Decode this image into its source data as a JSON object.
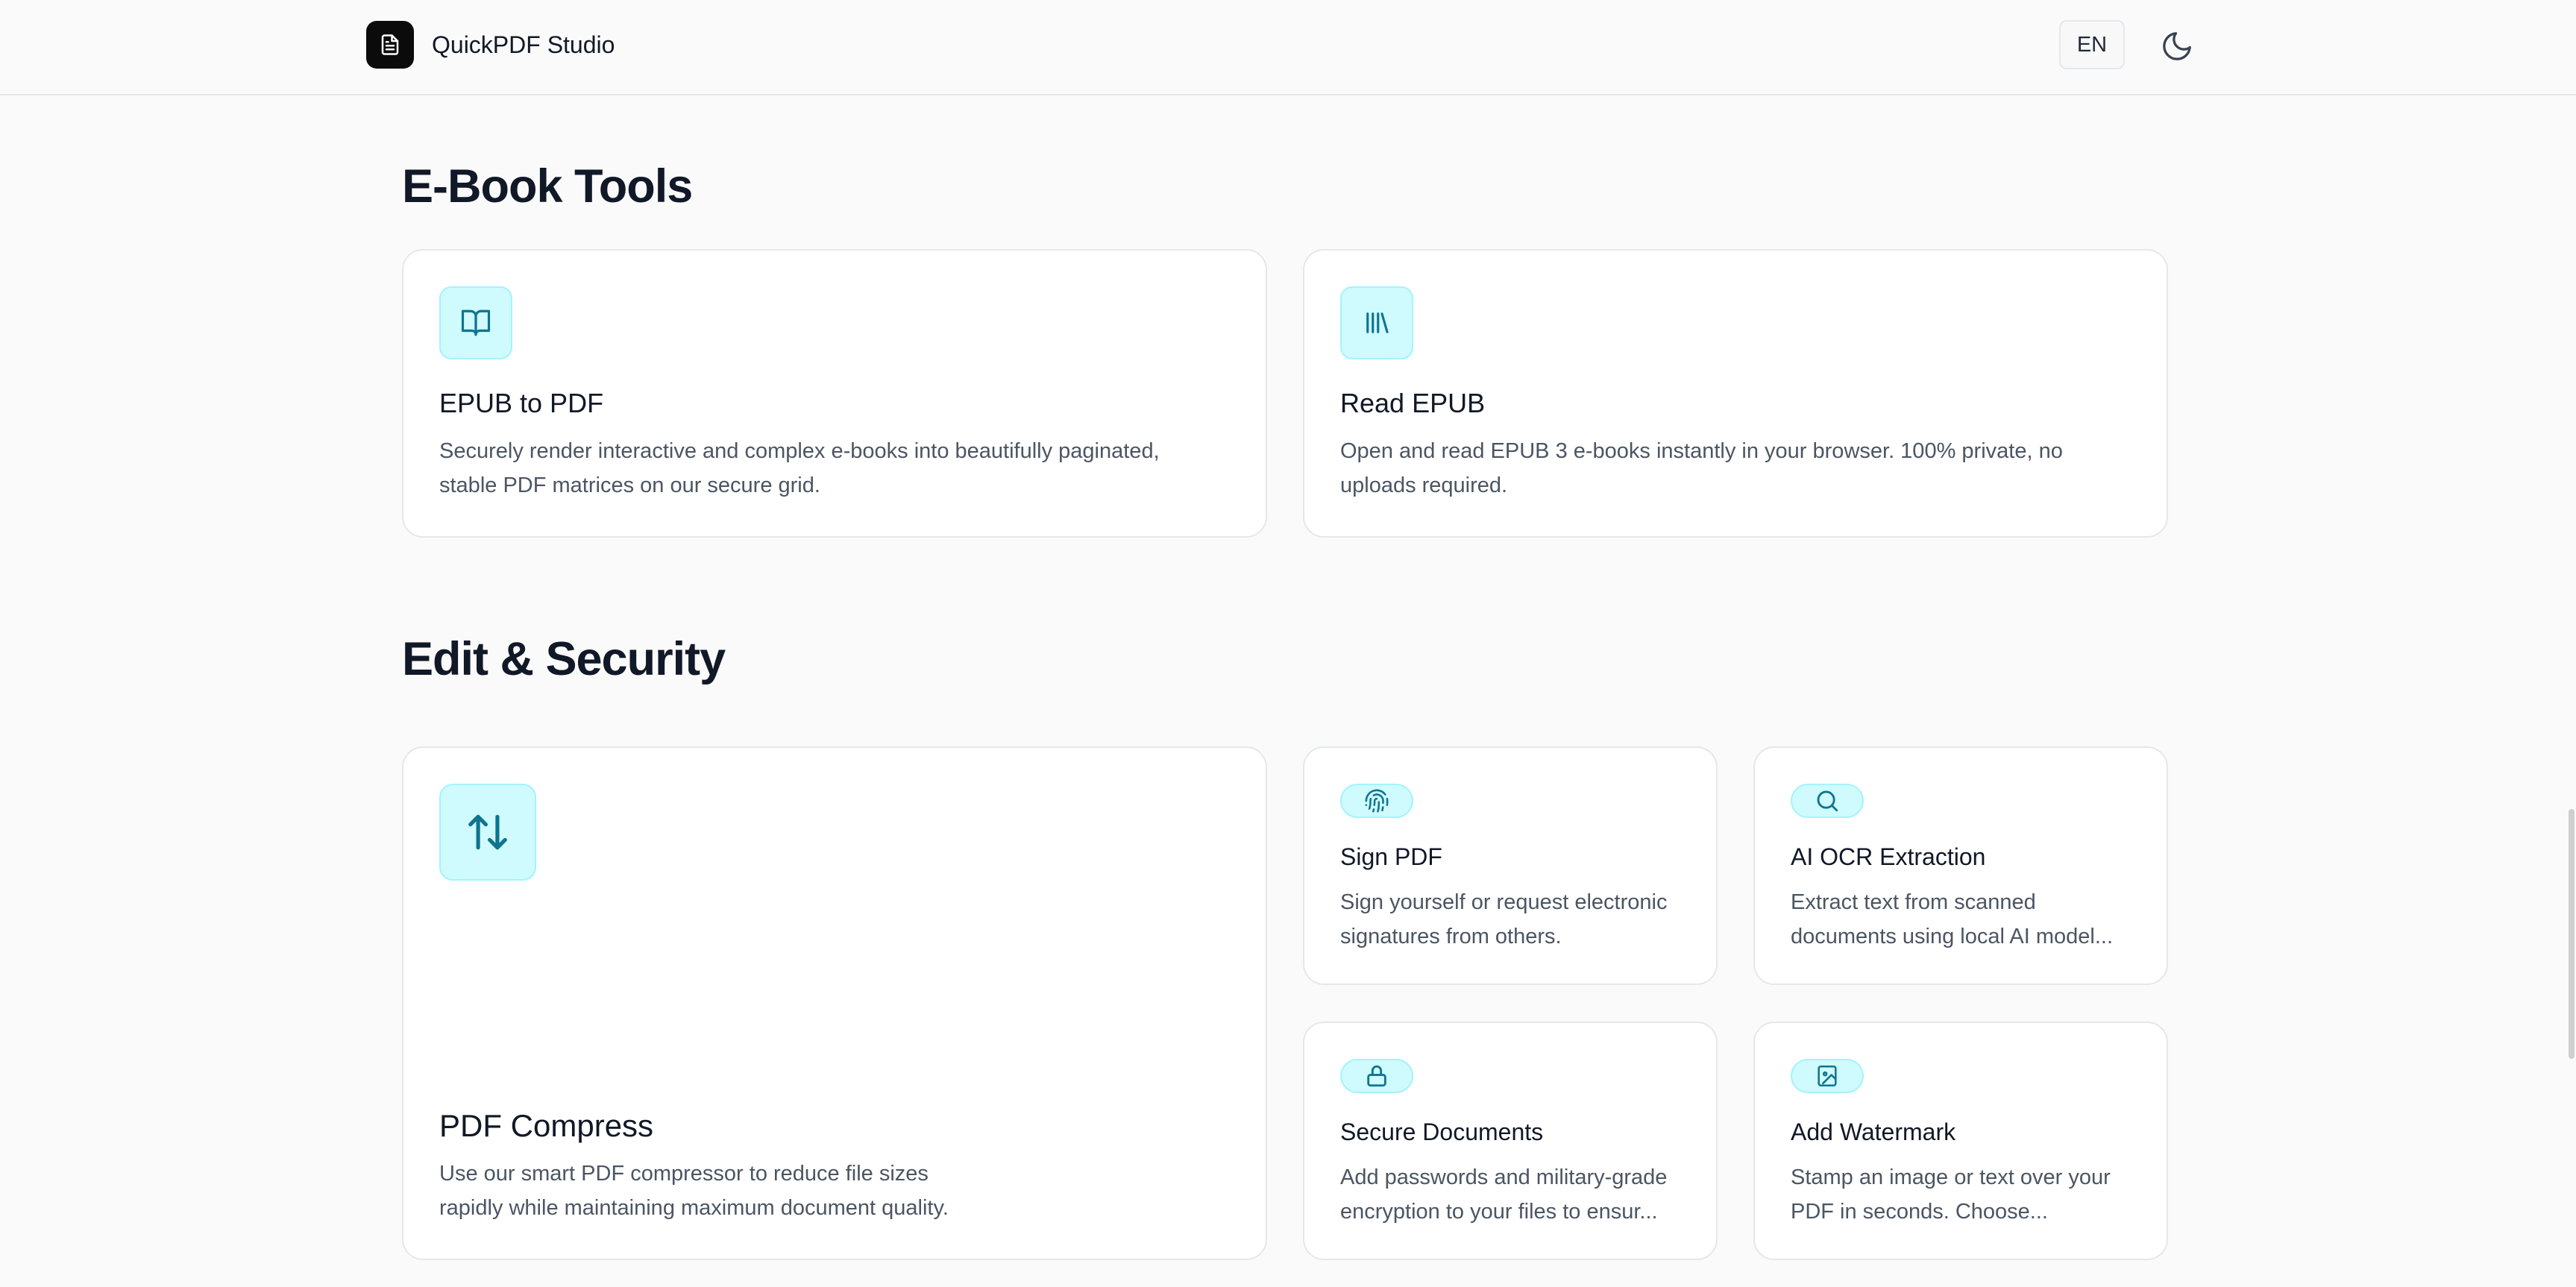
{
  "header": {
    "brand": "QuickPDF Studio",
    "language": "EN",
    "icons": {
      "logo": "file-text-icon",
      "theme": "moon-icon"
    }
  },
  "sections": {
    "ebook": {
      "title": "E-Book Tools",
      "cards": [
        {
          "title": "EPUB to PDF",
          "desc_lines": [
            "Securely render interactive and complex e-books into beautifully paginated,",
            "stable PDF matrices on our secure grid."
          ],
          "icon": "book-open-icon"
        },
        {
          "title": "Read EPUB",
          "desc_lines": [
            "Open and read EPUB 3 e-books instantly in your browser. 100% private, no",
            "uploads required."
          ],
          "icon": "library-icon"
        }
      ]
    },
    "edit": {
      "title": "Edit & Security",
      "cards": [
        {
          "title": "PDF Compress",
          "desc_lines": [
            "Use our smart PDF compressor to reduce file sizes",
            "rapidly while maintaining maximum document quality."
          ],
          "icon": "arrow-up-down-icon"
        },
        {
          "title": "Sign PDF",
          "desc_lines": [
            "Sign yourself or request electronic",
            "signatures from others."
          ],
          "icon": "fingerprint-icon"
        },
        {
          "title": "AI OCR Extraction",
          "desc_lines": [
            "Extract text from scanned",
            "documents using local AI model..."
          ],
          "icon": "search-icon"
        },
        {
          "title": "Secure Documents",
          "desc_lines": [
            "Add passwords and military-grade",
            "encryption to your files to ensur..."
          ],
          "icon": "lock-icon"
        },
        {
          "title": "Add Watermark",
          "desc_lines": [
            "Stamp an image or text over your",
            "PDF in seconds. Choose..."
          ],
          "icon": "file-image-icon"
        }
      ]
    }
  },
  "colors": {
    "accent": "#0e7490",
    "icon_bg": "#cffafe",
    "page_bg": "#fafafa",
    "card_border": "#e5e7eb"
  }
}
